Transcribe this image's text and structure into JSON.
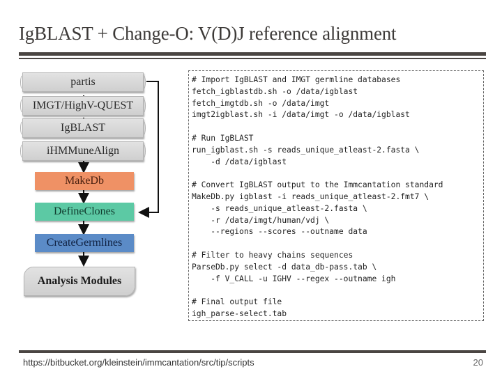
{
  "slide": {
    "title": "IgBLAST + Change-O:  V(D)J reference alignment",
    "footer_url": "https://bitbucket.org/kleinstein/immcantation/src/tip/scripts",
    "page_number": "20"
  },
  "diagram": {
    "aligners": [
      {
        "label": "partis"
      },
      {
        "label": "IMGT/HighV-QUEST"
      },
      {
        "label": "IgBLAST"
      },
      {
        "label": "iHMMuneAlign"
      }
    ],
    "steps": [
      {
        "label": "MakeDb",
        "color": "#ef9165",
        "text_color": "#4a2010"
      },
      {
        "label": "DefineClones",
        "color": "#5cc9a4",
        "text_color": "#0f3a2c"
      },
      {
        "label": "CreateGermlines",
        "color": "#5b8bc7",
        "text_color": "#0f2040"
      }
    ],
    "output": {
      "label": "Analysis Modules"
    },
    "edges": [
      {
        "from": "iHMMuneAlign",
        "to": "MakeDb"
      },
      {
        "from": "MakeDb",
        "to": "DefineClones"
      },
      {
        "from": "partis",
        "to": "DefineClones"
      },
      {
        "from": "DefineClones",
        "to": "CreateGermlines"
      },
      {
        "from": "CreateGermlines",
        "to": "Analysis Modules"
      }
    ]
  },
  "code": {
    "lines": [
      "# Import IgBLAST and IMGT germline databases",
      "fetch_igblastdb.sh -o /data/igblast",
      "fetch_imgtdb.sh -o /data/imgt",
      "imgt2igblast.sh -i /data/imgt -o /data/igblast",
      "",
      "# Run IgBLAST",
      "run_igblast.sh -s reads_unique_atleast-2.fasta \\",
      "    -d /data/igblast",
      "",
      "# Convert IgBLAST output to the Immcantation standard",
      "MakeDb.py igblast -i reads_unique_atleast-2.fmt7 \\",
      "    -s reads_unique_atleast-2.fasta \\",
      "    -r /data/imgt/human/vdj \\",
      "    --regions --scores --outname data",
      "",
      "# Filter to heavy chains sequences",
      "ParseDb.py select -d data_db-pass.tab \\",
      "    -f V_CALL -u IGHV --regex --outname igh",
      "",
      "# Final output file",
      "igh_parse-select.tab"
    ]
  }
}
